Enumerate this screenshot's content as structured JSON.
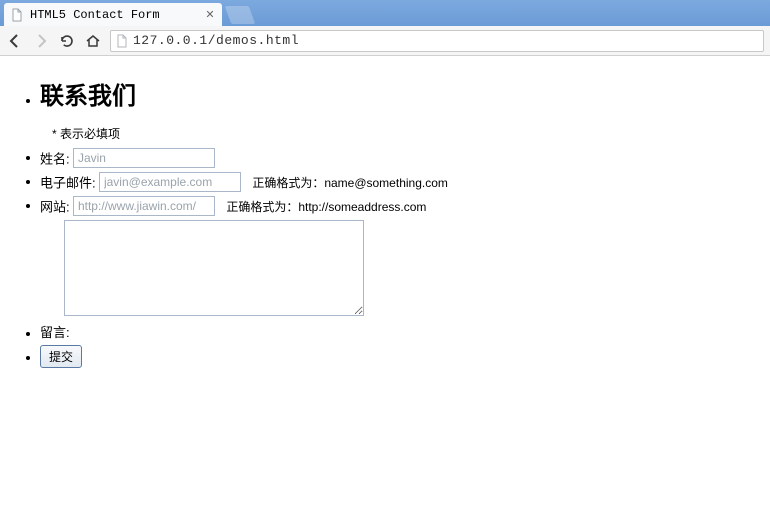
{
  "browser": {
    "tab_title": "HTML5 Contact Form",
    "url": "127.0.0.1/demos.html"
  },
  "page": {
    "heading": "联系我们",
    "required_note": "* 表示必填项",
    "fields": {
      "name": {
        "label": "姓名:",
        "placeholder": "Javin"
      },
      "email": {
        "label": "电子邮件:",
        "placeholder": "javin@example.com",
        "hint": "正确格式为：name@something.com"
      },
      "site": {
        "label": "网站:",
        "placeholder": "http://www.jiawin.com/",
        "hint": "正确格式为：http://someaddress.com"
      },
      "message": {
        "label": "留言:"
      }
    },
    "submit_label": "提交"
  }
}
